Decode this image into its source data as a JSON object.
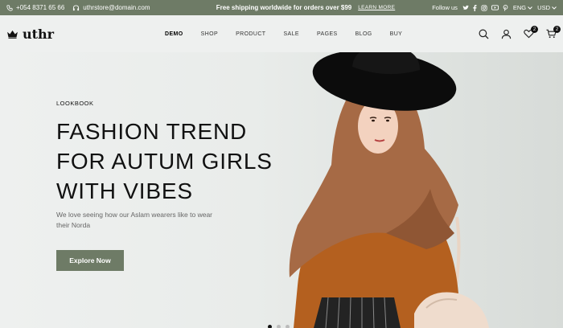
{
  "topbar": {
    "phone": "+054 8371 65 66",
    "email": "uthrstore@domain.com",
    "promo": "Free shipping worldwide for orders over $99",
    "promo_link": "LEARN MORE",
    "follow_label": "Follow us",
    "social_icons": [
      "twitter-icon",
      "facebook-icon",
      "instagram-icon",
      "youtube-icon",
      "pinterest-icon"
    ],
    "language": "ENG",
    "currency": "USD"
  },
  "header": {
    "logo_text": "uthr",
    "nav": [
      "DEMO",
      "SHOP",
      "PRODUCT",
      "SALE",
      "PAGES",
      "BLOG",
      "BUY"
    ],
    "active_nav": "DEMO",
    "wishlist_count": "2",
    "cart_count": "2"
  },
  "hero": {
    "eyebrow": "LOOKBOOK",
    "headline": [
      "FASHION TREND",
      "FOR AUTUM GIRLS",
      "WITH VIBES"
    ],
    "description": "We love seeing how our Aslam wearers like to wear their Norda",
    "cta_label": "Explore Now",
    "slides": 3,
    "active_slide": 1
  },
  "colors": {
    "accent": "#6e7b66",
    "background": "#eef0ef",
    "text": "#111111"
  }
}
